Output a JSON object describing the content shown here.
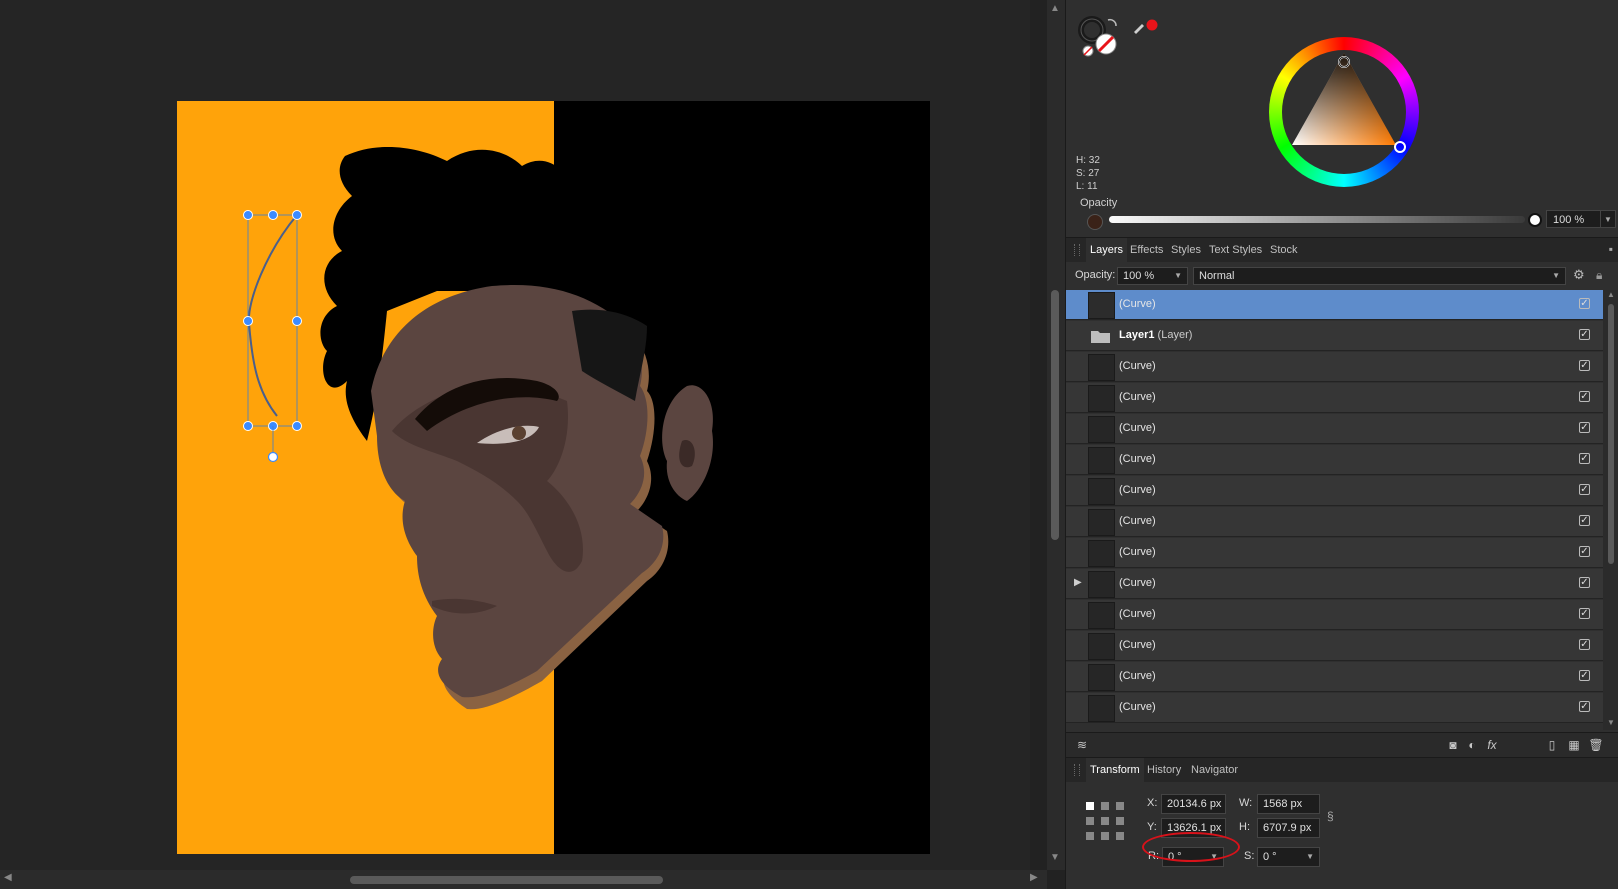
{
  "color": {
    "hsl": {
      "h": "H: 32",
      "s": "S: 27",
      "l": "L: 11"
    },
    "opacity_label": "Opacity",
    "opacity_value": "100 %",
    "accent_red": "#e8141a"
  },
  "canvas": {
    "background_left": "#ffa30a",
    "background_right": "#000000",
    "skin": "#5b4540",
    "skin_shadow": "#4a3632",
    "skin_rim": "#8a6242"
  },
  "layers_panel": {
    "tabs": [
      "Layers",
      "Effects",
      "Styles",
      "Text Styles",
      "Stock"
    ],
    "opacity_label": "Opacity:",
    "opacity_value": "100 %",
    "blend_mode": "Normal",
    "rows": [
      {
        "name": "(Curve)",
        "selected": true
      },
      {
        "name": "Layer1",
        "type": "(Layer)",
        "group": true
      },
      {
        "name": "(Curve)"
      },
      {
        "name": "(Curve)"
      },
      {
        "name": "(Curve)"
      },
      {
        "name": "(Curve)"
      },
      {
        "name": "(Curve)"
      },
      {
        "name": "(Curve)"
      },
      {
        "name": "(Curve)"
      },
      {
        "name": "(Curve)",
        "expandable": true
      },
      {
        "name": "(Curve)"
      },
      {
        "name": "(Curve)"
      },
      {
        "name": "(Curve)"
      },
      {
        "name": "(Curve)"
      }
    ],
    "footer_icons": [
      "layers-stack-icon",
      "mask-icon",
      "adjustment-icon",
      "fx-icon",
      "new-layer-icon",
      "pixel-layer-icon",
      "trash-icon"
    ]
  },
  "transform_panel": {
    "tabs": [
      "Transform",
      "History",
      "Navigator"
    ],
    "x_label": "X:",
    "x_value": "20134.6 px",
    "y_label": "Y:",
    "y_value": "13626.1 px",
    "w_label": "W:",
    "w_value": "1568 px",
    "h_label": "H:",
    "h_value": "6707.9 px",
    "r_label": "R:",
    "r_value": "0 °",
    "s_label": "S:",
    "s_value": "0 °"
  }
}
